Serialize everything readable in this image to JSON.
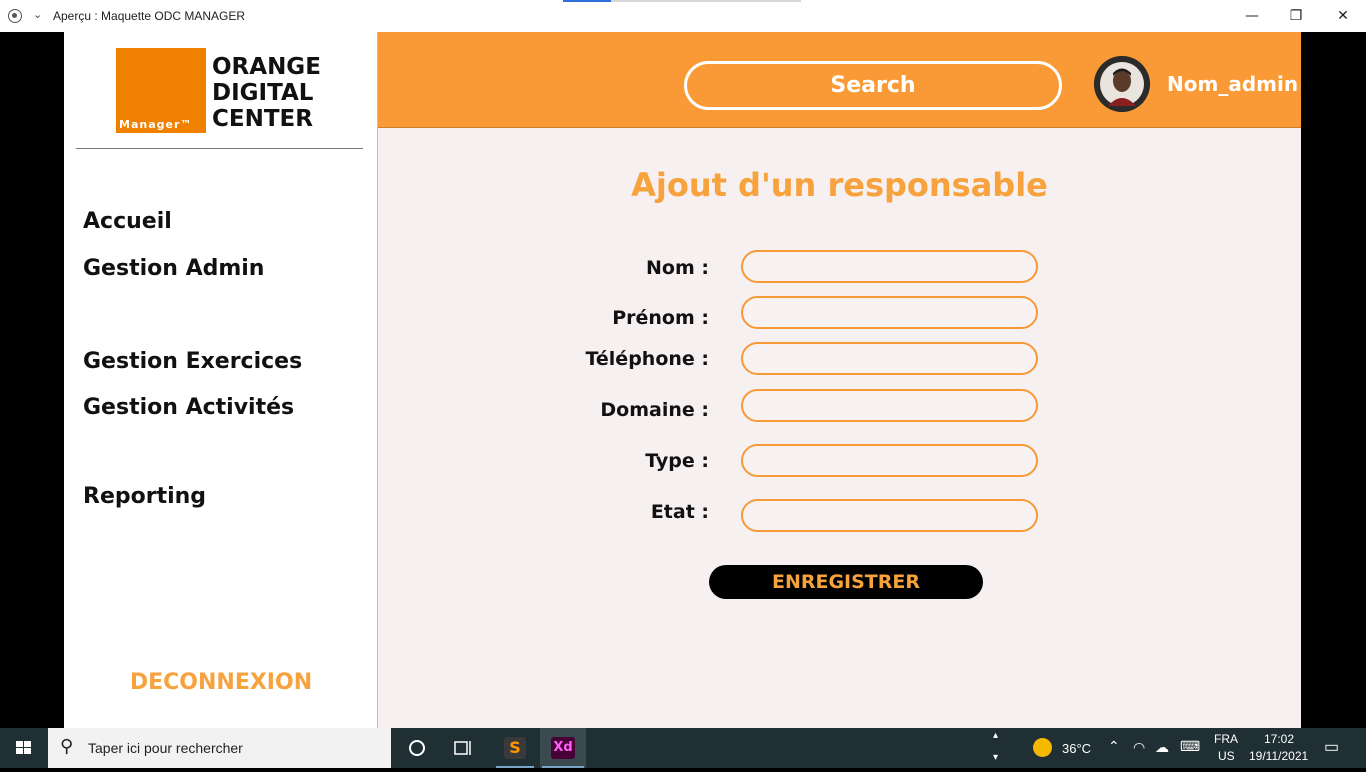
{
  "window": {
    "title": "Aperçu : Maquette ODC MANAGER",
    "minimize_glyph": "—",
    "maximize_glyph": "❐",
    "close_glyph": "✕"
  },
  "logo": {
    "badge_text": "Manager™",
    "line1": "ORANGE",
    "line2": "DIGITAL",
    "line3": "CENTER",
    "color": "#f08000"
  },
  "sidebar": {
    "items": [
      {
        "label": "Accueil"
      },
      {
        "label": "Gestion Admin"
      },
      {
        "label": "Gestion Exercices"
      },
      {
        "label": "Gestion Activités"
      },
      {
        "label": "Reporting"
      }
    ],
    "logout_label": "DECONNEXION"
  },
  "header": {
    "search_placeholder": "Search",
    "admin_name": "Nom_admin",
    "color": "#f99a36"
  },
  "form": {
    "title": "Ajout d'un responsable",
    "fields": [
      {
        "label": "Nom :",
        "value": ""
      },
      {
        "label": "Prénom :",
        "value": ""
      },
      {
        "label": "Téléphone :",
        "value": ""
      },
      {
        "label": "Domaine :",
        "value": ""
      },
      {
        "label": "Type :",
        "value": ""
      },
      {
        "label": "Etat :",
        "value": ""
      }
    ],
    "submit_label": "ENREGISTRER",
    "accent": "#f7a23c"
  },
  "taskbar": {
    "search_placeholder": "Taper ici pour rechercher",
    "weather": "36°C",
    "lang_top": "FRA",
    "lang_bottom": "US",
    "time": "17:02",
    "date": "19/11/2021",
    "apps": [
      {
        "icon": "cortana-icon"
      },
      {
        "icon": "task-view-icon"
      },
      {
        "icon": "sublime-text-icon",
        "glyph": "S"
      },
      {
        "icon": "adobe-xd-icon",
        "glyph": "Xd"
      }
    ]
  }
}
